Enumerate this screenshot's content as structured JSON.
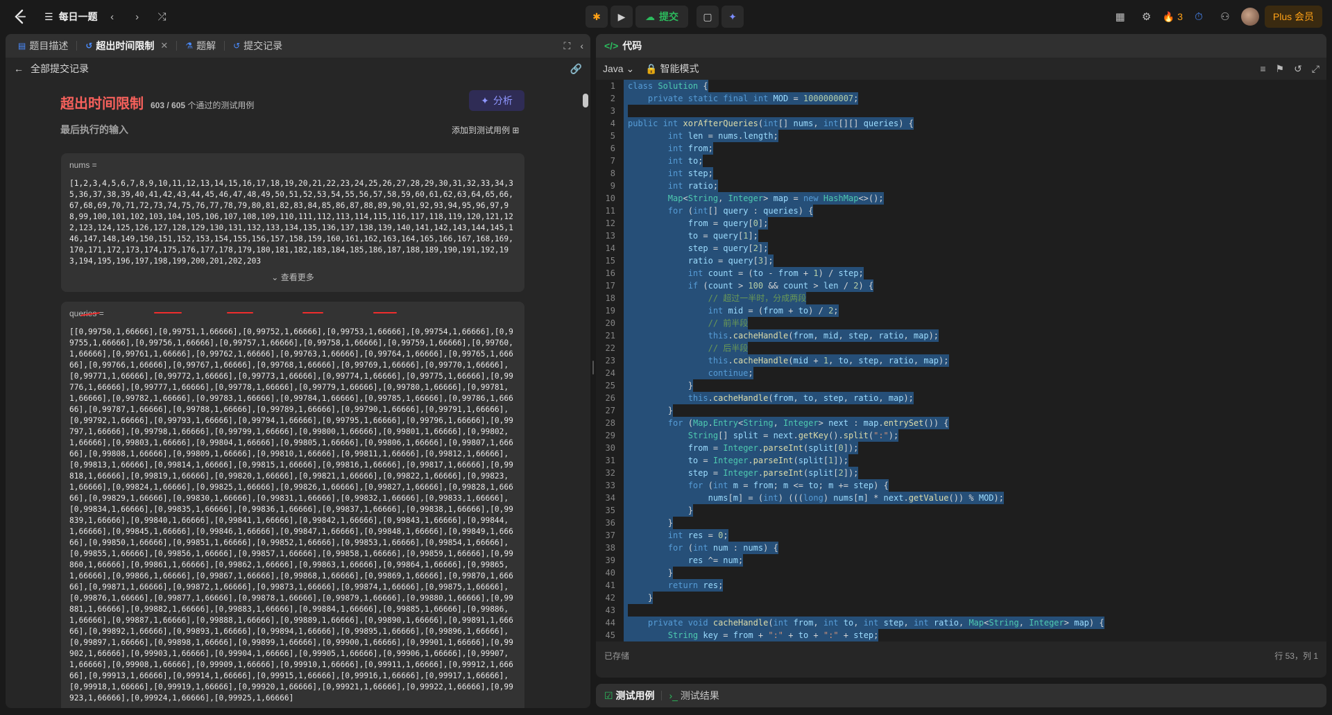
{
  "topbar": {
    "problem_list": "每日一题",
    "submit": "提交",
    "streak": "3",
    "plus": "Plus 会员"
  },
  "left": {
    "tabs": [
      {
        "label": "题目描述"
      },
      {
        "label": "超出时间限制"
      },
      {
        "label": "题解"
      },
      {
        "label": "提交记录"
      }
    ],
    "back_label": "全部提交记录",
    "verdict": "超出时间限制",
    "pass_count": "603 / 605",
    "pass_suffix": "个通过的测试用例",
    "analyze": "分析",
    "last_input": "最后执行的输入",
    "add_case": "添加到测试用例",
    "nums_label": "nums =",
    "nums_value": "[1,2,3,4,5,6,7,8,9,10,11,12,13,14,15,16,17,18,19,20,21,22,23,24,25,26,27,28,29,30,31,32,33,34,35,36,37,38,39,40,41,42,43,44,45,46,47,48,49,50,51,52,53,54,55,56,57,58,59,60,61,62,63,64,65,66,67,68,69,70,71,72,73,74,75,76,77,78,79,80,81,82,83,84,85,86,87,88,89,90,91,92,93,94,95,96,97,98,99,100,101,102,103,104,105,106,107,108,109,110,111,112,113,114,115,116,117,118,119,120,121,122,123,124,125,126,127,128,129,130,131,132,133,134,135,136,137,138,139,140,141,142,143,144,145,146,147,148,149,150,151,152,153,154,155,156,157,158,159,160,161,162,163,164,165,166,167,168,169,170,171,172,173,174,175,176,177,178,179,180,181,182,183,184,185,186,187,188,189,190,191,192,193,194,195,196,197,198,199,200,201,202,203",
    "see_more": "查看更多",
    "queries_label": "queries =",
    "queries_value": "[[0,99750,1,66666],[0,99751,1,66666],[0,99752,1,66666],[0,99753,1,66666],[0,99754,1,66666],[0,99755,1,66666],[0,99756,1,66666],[0,99757,1,66666],[0,99758,1,66666],[0,99759,1,66666],[0,99760,1,66666],[0,99761,1,66666],[0,99762,1,66666],[0,99763,1,66666],[0,99764,1,66666],[0,99765,1,66666],[0,99766,1,66666],[0,99767,1,66666],[0,99768,1,66666],[0,99769,1,66666],[0,99770,1,66666],[0,99771,1,66666],[0,99772,1,66666],[0,99773,1,66666],[0,99774,1,66666],[0,99775,1,66666],[0,99776,1,66666],[0,99777,1,66666],[0,99778,1,66666],[0,99779,1,66666],[0,99780,1,66666],[0,99781,1,66666],[0,99782,1,66666],[0,99783,1,66666],[0,99784,1,66666],[0,99785,1,66666],[0,99786,1,66666],[0,99787,1,66666],[0,99788,1,66666],[0,99789,1,66666],[0,99790,1,66666],[0,99791,1,66666],[0,99792,1,66666],[0,99793,1,66666],[0,99794,1,66666],[0,99795,1,66666],[0,99796,1,66666],[0,99797,1,66666],[0,99798,1,66666],[0,99799,1,66666],[0,99800,1,66666],[0,99801,1,66666],[0,99802,1,66666],[0,99803,1,66666],[0,99804,1,66666],[0,99805,1,66666],[0,99806,1,66666],[0,99807,1,66666],[0,99808,1,66666],[0,99809,1,66666],[0,99810,1,66666],[0,99811,1,66666],[0,99812,1,66666],[0,99813,1,66666],[0,99814,1,66666],[0,99815,1,66666],[0,99816,1,66666],[0,99817,1,66666],[0,99818,1,66666],[0,99819,1,66666],[0,99820,1,66666],[0,99821,1,66666],[0,99822,1,66666],[0,99823,1,66666],[0,99824,1,66666],[0,99825,1,66666],[0,99826,1,66666],[0,99827,1,66666],[0,99828,1,66666],[0,99829,1,66666],[0,99830,1,66666],[0,99831,1,66666],[0,99832,1,66666],[0,99833,1,66666],[0,99834,1,66666],[0,99835,1,66666],[0,99836,1,66666],[0,99837,1,66666],[0,99838,1,66666],[0,99839,1,66666],[0,99840,1,66666],[0,99841,1,66666],[0,99842,1,66666],[0,99843,1,66666],[0,99844,1,66666],[0,99845,1,66666],[0,99846,1,66666],[0,99847,1,66666],[0,99848,1,66666],[0,99849,1,66666],[0,99850,1,66666],[0,99851,1,66666],[0,99852,1,66666],[0,99853,1,66666],[0,99854,1,66666],[0,99855,1,66666],[0,99856,1,66666],[0,99857,1,66666],[0,99858,1,66666],[0,99859,1,66666],[0,99860,1,66666],[0,99861,1,66666],[0,99862,1,66666],[0,99863,1,66666],[0,99864,1,66666],[0,99865,1,66666],[0,99866,1,66666],[0,99867,1,66666],[0,99868,1,66666],[0,99869,1,66666],[0,99870,1,66666],[0,99871,1,66666],[0,99872,1,66666],[0,99873,1,66666],[0,99874,1,66666],[0,99875,1,66666],[0,99876,1,66666],[0,99877,1,66666],[0,99878,1,66666],[0,99879,1,66666],[0,99880,1,66666],[0,99881,1,66666],[0,99882,1,66666],[0,99883,1,66666],[0,99884,1,66666],[0,99885,1,66666],[0,99886,1,66666],[0,99887,1,66666],[0,99888,1,66666],[0,99889,1,66666],[0,99890,1,66666],[0,99891,1,66666],[0,99892,1,66666],[0,99893,1,66666],[0,99894,1,66666],[0,99895,1,66666],[0,99896,1,66666],[0,99897,1,66666],[0,99898,1,66666],[0,99899,1,66666],[0,99900,1,66666],[0,99901,1,66666],[0,99902,1,66666],[0,99903,1,66666],[0,99904,1,66666],[0,99905,1,66666],[0,99906,1,66666],[0,99907,1,66666],[0,99908,1,66666],[0,99909,1,66666],[0,99910,1,66666],[0,99911,1,66666],[0,99912,1,66666],[0,99913,1,66666],[0,99914,1,66666],[0,99915,1,66666],[0,99916,1,66666],[0,99917,1,66666],[0,99918,1,66666],[0,99919,1,66666],[0,99920,1,66666],[0,99921,1,66666],[0,99922,1,66666],[0,99923,1,66666],[0,99924,1,66666],[0,99925,1,66666]"
  },
  "right": {
    "title": "代码",
    "language": "Java",
    "mode": "智能模式",
    "saved": "已存储",
    "cursor": "行 53，列 1",
    "bottom_tabs": [
      "测试用例",
      "测试结果"
    ]
  }
}
